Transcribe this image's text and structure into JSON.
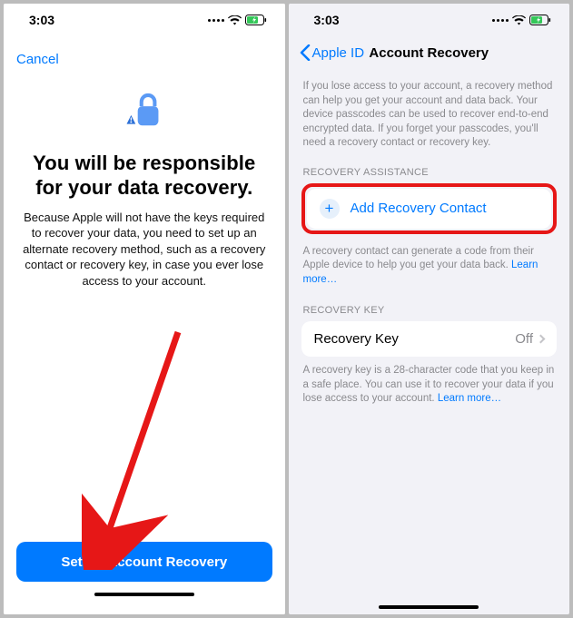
{
  "left": {
    "status_time": "3:03",
    "cancel": "Cancel",
    "headline": "You will be responsible for your data recovery.",
    "body": "Because Apple will not have the keys required to recover your data, you need to set up an alternate recovery method, such as a recovery contact or recovery key, in case you ever lose access to your account.",
    "button": "Set Up Account Recovery"
  },
  "right": {
    "status_time": "3:03",
    "back_label": "Apple ID",
    "title": "Account Recovery",
    "intro": "If you lose access to your account, a recovery method can help you get your account and data back. Your device passcodes can be used to recover end-to-end encrypted data. If you forget your passcodes, you'll need a recovery contact or recovery key.",
    "section_assist": "RECOVERY ASSISTANCE",
    "add_contact": "Add Recovery Contact",
    "assist_footer": "A recovery contact can generate a code from their Apple device to help you get your data back. ",
    "learn_more": "Learn more…",
    "section_key": "RECOVERY KEY",
    "key_label": "Recovery Key",
    "key_value": "Off",
    "key_footer": "A recovery key is a 28-character code that you keep in a safe place. You can use it to recover your data if you lose access to your account. "
  }
}
